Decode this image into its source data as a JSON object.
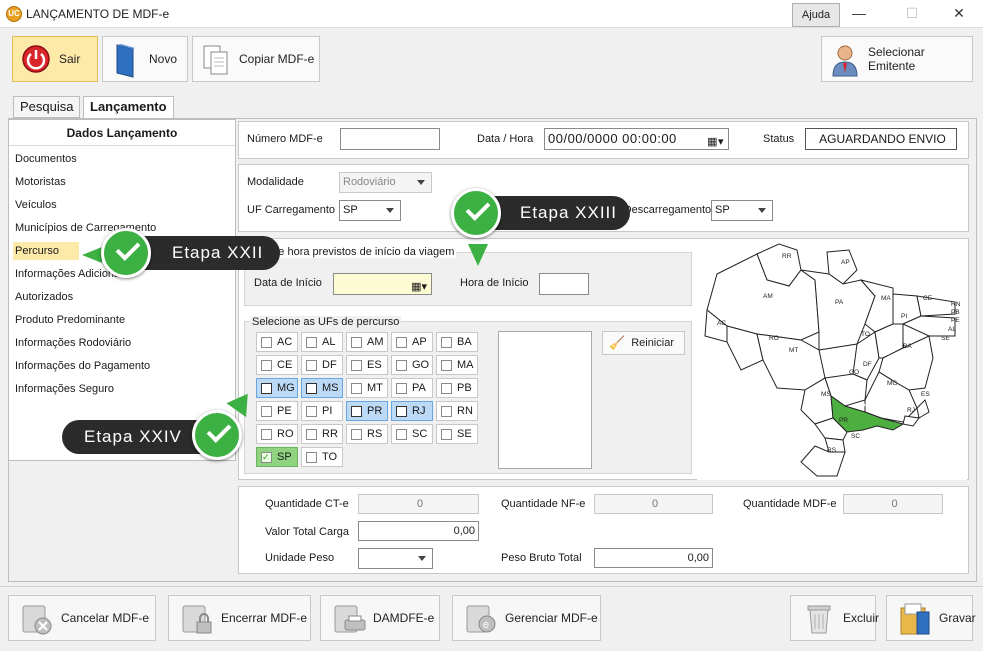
{
  "window": {
    "title": "LANÇAMENTO DE MDF-e",
    "help_label": "Ajuda"
  },
  "toolbar": {
    "sair": "Sair",
    "novo": "Novo",
    "copiar": "Copiar MDF-e",
    "selecionar_emitente": "Selecionar Emitente"
  },
  "tabs": [
    {
      "label": "Pesquisa"
    },
    {
      "label": "Lançamento"
    }
  ],
  "sidebar": {
    "header": "Dados Lançamento",
    "items": [
      {
        "label": "Documentos"
      },
      {
        "label": "Motoristas"
      },
      {
        "label": "Veículos"
      },
      {
        "label": "Municípios de Carregamento"
      },
      {
        "label": "Percurso"
      },
      {
        "label": "Informações Adicionais"
      },
      {
        "label": "Autorizados"
      },
      {
        "label": "Produto Predominante"
      },
      {
        "label": "Informações Rodoviário"
      },
      {
        "label": "Informações do Pagamento"
      },
      {
        "label": "Informações Seguro"
      }
    ]
  },
  "header_fields": {
    "numero_label": "Número MDF-e",
    "numero_value": "",
    "data_hora_label": "Data / Hora",
    "data_hora_value": "00/00/0000 00:00:00",
    "status_label": "Status",
    "status_value": "AGUARDANDO ENVIO"
  },
  "modal": {
    "modalidade_label": "Modalidade",
    "modalidade_value": "Rodoviário",
    "uf_carreg_label": "UF Carregamento",
    "uf_carreg_value": "SP",
    "uf_descarreg_label": "UF Descarregamento",
    "uf_descarreg_value": "SP"
  },
  "inicio": {
    "group_title": "Data e hora previstos de início da viagem",
    "data_label": "Data de Início",
    "data_value": "",
    "hora_label": "Hora de Início",
    "hora_value": ""
  },
  "ufs": {
    "group_title": "Selecione as UFs de percurso",
    "reiniciar": "Reiniciar",
    "rows": [
      [
        "AC",
        "AL",
        "AM",
        "AP",
        "BA"
      ],
      [
        "CE",
        "DF",
        "ES",
        "GO",
        "MA"
      ],
      [
        "MG",
        "MS",
        "MT",
        "PA",
        "PB"
      ],
      [
        "PE",
        "PI",
        "PR",
        "RJ",
        "RN"
      ],
      [
        "RO",
        "RR",
        "RS",
        "SC",
        "SE"
      ],
      [
        "SP",
        "TO"
      ]
    ],
    "highlighted_blue": [
      "MG",
      "MS",
      "PR",
      "RJ"
    ],
    "highlighted_green": [
      "SP"
    ]
  },
  "map": {
    "states": [
      "RR",
      "AP",
      "AM",
      "PA",
      "MA",
      "CE",
      "RN",
      "PB",
      "PE",
      "AL",
      "SE",
      "AC",
      "RO",
      "TO",
      "PI",
      "BA",
      "MT",
      "GO",
      "DF",
      "MG",
      "ES",
      "MS",
      "SP",
      "RJ",
      "PR",
      "SC",
      "RS"
    ],
    "highlight_state": "SP",
    "highlight_color": "#4caf3f"
  },
  "totals": {
    "qtd_cte_label": "Quantidade CT-e",
    "qtd_cte_value": "0",
    "qtd_nfe_label": "Quantidade NF-e",
    "qtd_nfe_value": "0",
    "qtd_mdfe_label": "Quantidade MDF-e",
    "qtd_mdfe_value": "0",
    "valor_total_label": "Valor Total Carga",
    "valor_total_value": "0,00",
    "unidade_peso_label": "Unidade Peso",
    "unidade_peso_value": "",
    "peso_bruto_label": "Peso Bruto Total",
    "peso_bruto_value": "0,00"
  },
  "bottom": {
    "cancelar": "Cancelar MDF-e",
    "encerrar": "Encerrar MDF-e",
    "damdfe": "DAMDFE-e",
    "gerenciar": "Gerenciar MDF-e",
    "excluir": "Excluir",
    "gravar": "Gravar"
  },
  "annotations": {
    "etapa_22": "Etapa XXII",
    "etapa_23": "Etapa XXIII",
    "etapa_24": "Etapa XXIV"
  }
}
